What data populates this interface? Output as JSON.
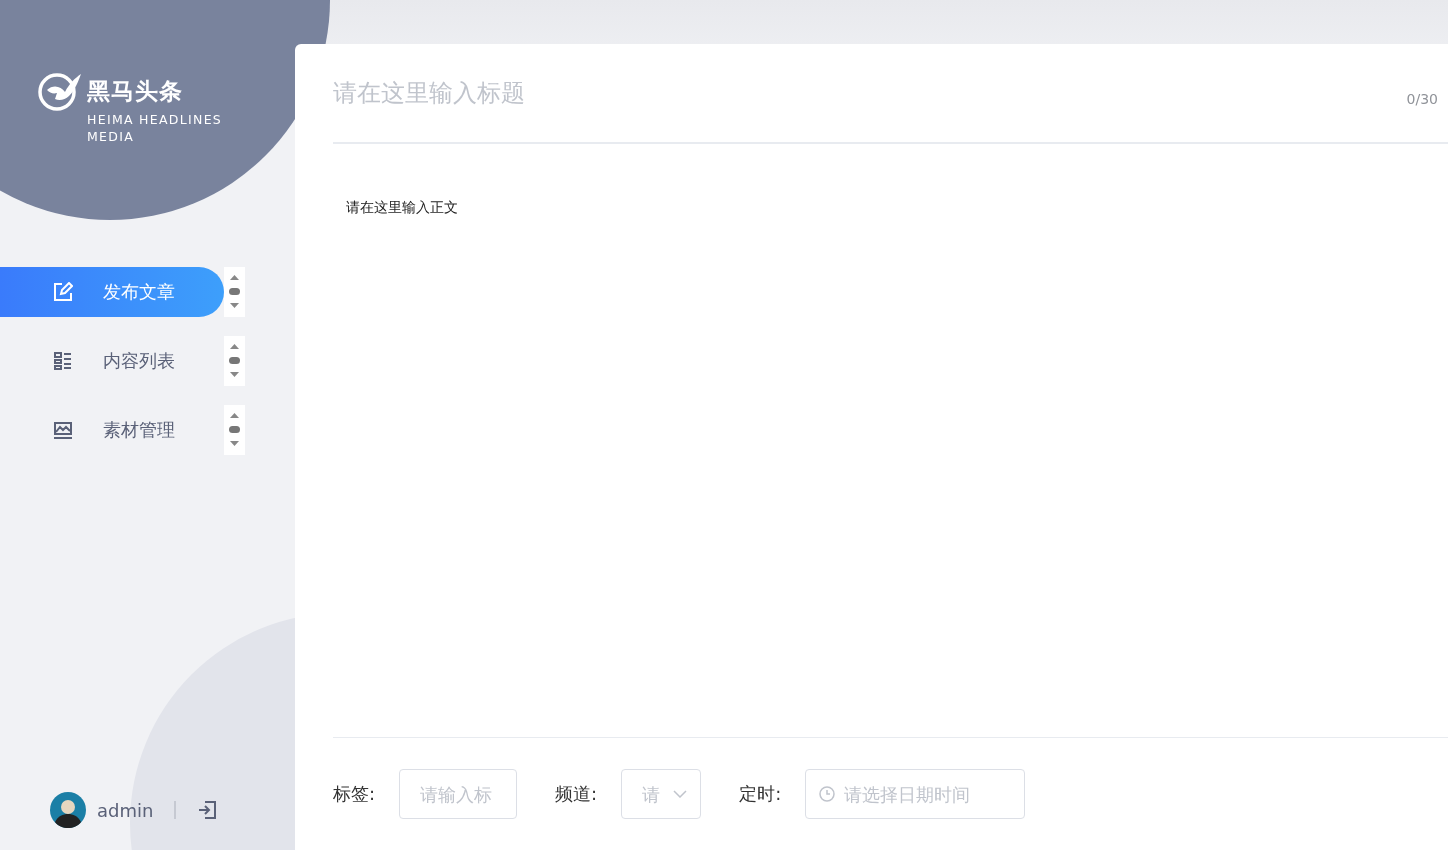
{
  "brand": {
    "name": "黑马头条",
    "subtitle": "HEIMA HEADLINES MEDIA"
  },
  "nav": [
    {
      "label": "发布文章",
      "kind": "edit",
      "selected": true
    },
    {
      "label": "内容列表",
      "kind": "list",
      "selected": false
    },
    {
      "label": "素材管理",
      "kind": "image",
      "selected": false
    }
  ],
  "user": {
    "name": "admin"
  },
  "editor": {
    "title_placeholder": "请在这里输入标题",
    "counter": "0/30",
    "body": "请在这里输入正文"
  },
  "footer": [
    {
      "label": "标签:",
      "kind": "input",
      "placeholder": "请输入标"
    },
    {
      "label": "频道:",
      "kind": "select",
      "placeholder": "请"
    },
    {
      "label": "定时:",
      "kind": "date",
      "placeholder": "请选择日期时间"
    }
  ]
}
